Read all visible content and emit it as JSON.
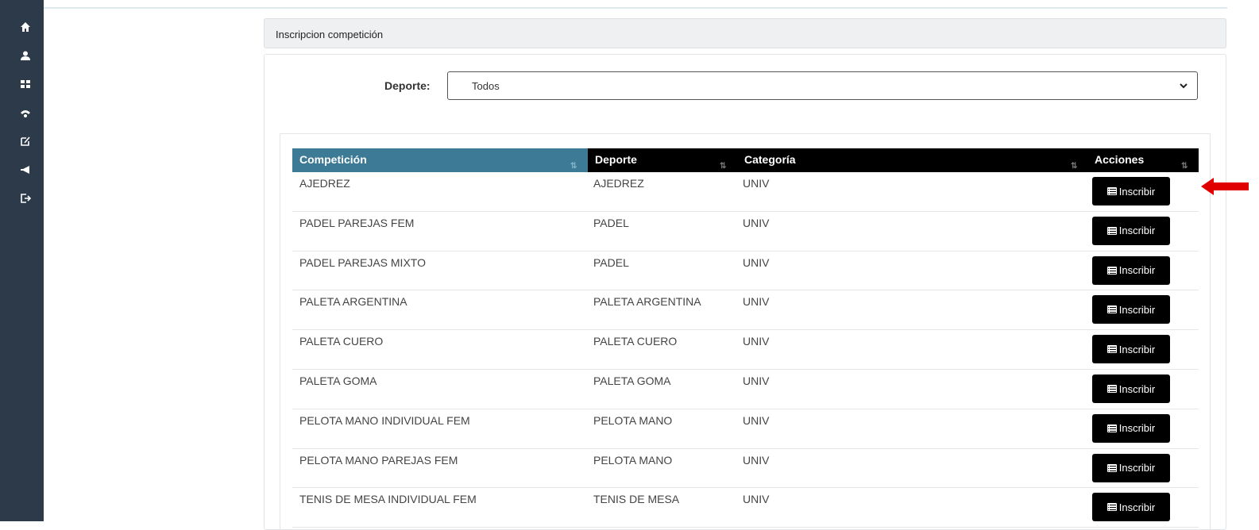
{
  "sidebar": {
    "icons": [
      "home-icon",
      "user-icon",
      "grid-icon",
      "signal-icon",
      "edit-icon",
      "megaphone-icon",
      "logout-icon"
    ]
  },
  "panel": {
    "title": "Inscripcion competición"
  },
  "filter": {
    "label": "Deporte:",
    "selected": "Todos"
  },
  "table": {
    "headers": {
      "competicion": "Competición",
      "deporte": "Deporte",
      "categoria": "Categoría",
      "acciones": "Acciones"
    },
    "action_label": "Inscribir",
    "rows": [
      {
        "competicion": "AJEDREZ",
        "deporte": "AJEDREZ",
        "categoria": "UNIV"
      },
      {
        "competicion": "PADEL PAREJAS FEM",
        "deporte": "PADEL",
        "categoria": "UNIV"
      },
      {
        "competicion": "PADEL PAREJAS MIXTO",
        "deporte": "PADEL",
        "categoria": "UNIV"
      },
      {
        "competicion": "PALETA ARGENTINA",
        "deporte": "PALETA ARGENTINA",
        "categoria": "UNIV"
      },
      {
        "competicion": "PALETA CUERO",
        "deporte": "PALETA CUERO",
        "categoria": "UNIV"
      },
      {
        "competicion": "PALETA GOMA",
        "deporte": "PALETA GOMA",
        "categoria": "UNIV"
      },
      {
        "competicion": "PELOTA MANO INDIVIDUAL FEM",
        "deporte": "PELOTA MANO",
        "categoria": "UNIV"
      },
      {
        "competicion": "PELOTA MANO PAREJAS FEM",
        "deporte": "PELOTA MANO",
        "categoria": "UNIV"
      },
      {
        "competicion": "TENIS DE MESA INDIVIDUAL FEM",
        "deporte": "TENIS DE MESA",
        "categoria": "UNIV"
      }
    ]
  },
  "colors": {
    "sidebar": "#2d3a4a",
    "header_sorted": "#3c7a96",
    "header": "#000000",
    "arrow": "#e00000"
  }
}
